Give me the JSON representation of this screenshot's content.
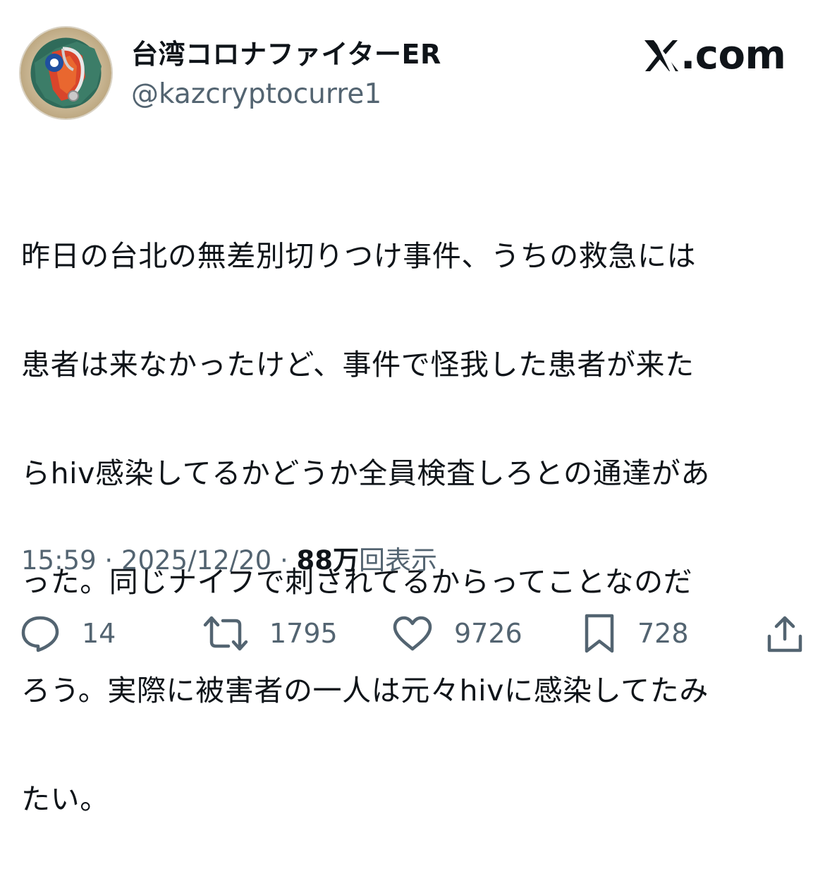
{
  "author": {
    "display_name": "台湾コロナファイターER",
    "handle": "@kazcryptocurre1",
    "avatar_icon": "taiwan-stethoscope-avatar-icon"
  },
  "brand": {
    "label": "com",
    "icon": "x-logo-icon"
  },
  "tweet": {
    "lines": [
      "昨日の台北の無差別切りつけ事件、うちの救急には",
      "患者は来なかったけど、事件で怪我した患者が来た",
      "らhiv感染してるかどうか全員検査しろとの通達があ",
      "った。同じナイフで刺されてるからってことなのだ",
      "ろう。実際に被害者の一人は元々hivに感染してたみ",
      "たい。"
    ]
  },
  "meta": {
    "time": "15:59",
    "separator": "·",
    "date": "2025/12/20",
    "views_count": "88万",
    "views_label": "回表示"
  },
  "actions": {
    "replies": {
      "count": "14",
      "icon": "reply-icon"
    },
    "reposts": {
      "count": "1795",
      "icon": "repost-icon"
    },
    "likes": {
      "count": "9726",
      "icon": "heart-icon"
    },
    "bookmarks": {
      "count": "728",
      "icon": "bookmark-icon"
    },
    "share": {
      "icon": "share-icon"
    }
  },
  "colors": {
    "text_primary": "#0f1419",
    "text_secondary": "#536471",
    "background": "#ffffff"
  }
}
